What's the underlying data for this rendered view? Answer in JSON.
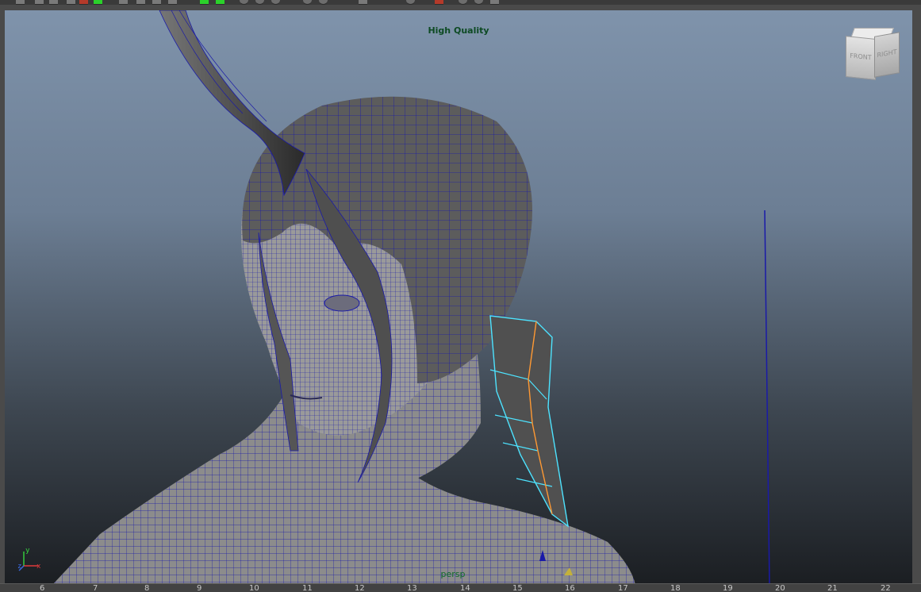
{
  "toolbar": {
    "icons": [
      "select-tool-icon",
      "lasso-tool-icon",
      "paint-select-icon",
      "move-tool-icon",
      "rotate-tool-icon",
      "scale-tool-icon",
      "snap-grid-icon",
      "snap-curve-icon",
      "snap-point-icon",
      "camera-icon",
      "render-icon",
      "ipr-render-icon",
      "display-settings-icon",
      "lighting-icon",
      "shadows-icon",
      "isolate-select-icon",
      "xray-icon",
      "grid-toggle-icon",
      "audio-icon"
    ]
  },
  "viewport": {
    "renderer_label": "High Quality",
    "camera_label": "persp",
    "viewcube": {
      "front_label": "FRONT",
      "right_label": "RIGHT"
    },
    "axis": {
      "x": "x",
      "y": "y",
      "z": "z"
    },
    "colors": {
      "wireframe": "#1a1aa8",
      "selection": "#4de3ff",
      "active_edge": "#ff9933",
      "mesh_shade": "#8c8c8c"
    }
  },
  "timeline": {
    "ticks": [
      "6",
      "7",
      "8",
      "9",
      "10",
      "11",
      "12",
      "13",
      "14",
      "15",
      "16",
      "17",
      "18",
      "19",
      "20",
      "21",
      "22"
    ]
  }
}
